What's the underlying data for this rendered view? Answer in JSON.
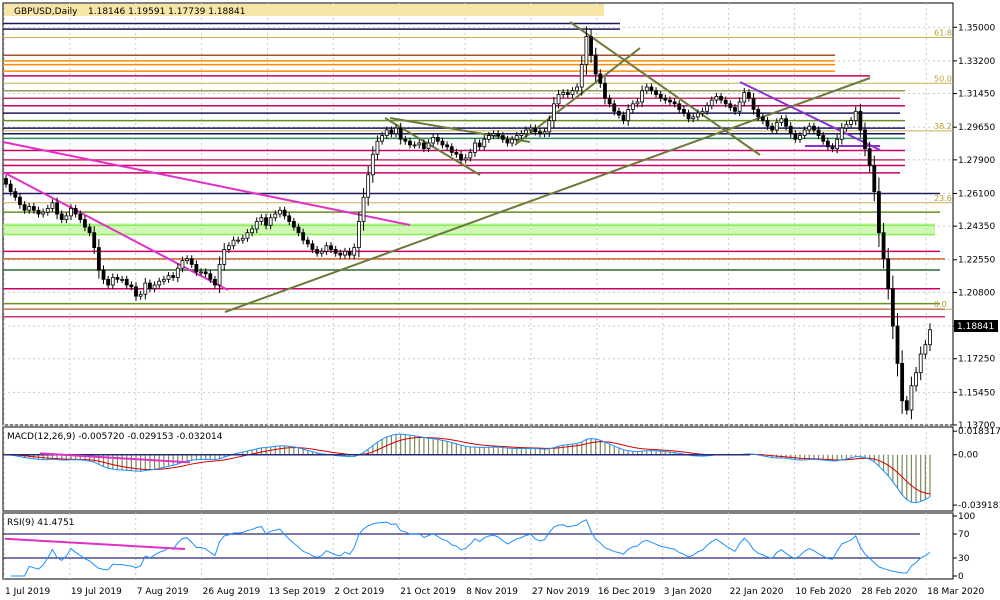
{
  "chart_data": [
    {
      "type": "candlestick",
      "title": "GBPUSD,Daily",
      "ohlc_header": "1.18146 1.19591 1.17739 1.18841",
      "last_price": "1.18841",
      "ylim": [
        1.137,
        1.363
      ],
      "y_ticks": [
        "1.35000",
        "1.33200",
        "1.31450",
        "1.29650",
        "1.27900",
        "1.26100",
        "1.24350",
        "1.22550",
        "1.20800",
        "1.19000",
        "1.17250",
        "1.15450",
        "1.13700"
      ],
      "x_ticks": [
        "1 Jul 2019",
        "19 Jul 2019",
        "7 Aug 2019",
        "26 Aug 2019",
        "13 Sep 2019",
        "2 Oct 2019",
        "21 Oct 2019",
        "8 Nov 2019",
        "27 Nov 2019",
        "16 Dec 2019",
        "3 Jan 2020",
        "22 Jan 2020",
        "10 Feb 2020",
        "28 Feb 2020",
        "18 Mar 2020"
      ],
      "fib_levels": [
        {
          "label": "61.8",
          "value": 1.3445
        },
        {
          "label": "50.0",
          "value": 1.32
        },
        {
          "label": "38.2",
          "value": 1.2945
        },
        {
          "label": "23.6",
          "value": 1.256
        },
        {
          "label": "0.0",
          "value": 1.199
        }
      ],
      "closes": [
        1.266,
        1.262,
        1.259,
        1.255,
        1.252,
        1.254,
        1.252,
        1.25,
        1.251,
        1.253,
        1.256,
        1.25,
        1.247,
        1.249,
        1.253,
        1.25,
        1.247,
        1.243,
        1.24,
        1.232,
        1.22,
        1.215,
        1.212,
        1.216,
        1.215,
        1.215,
        1.212,
        1.211,
        1.206,
        1.207,
        1.213,
        1.21,
        1.212,
        1.214,
        1.215,
        1.217,
        1.216,
        1.221,
        1.225,
        1.226,
        1.223,
        1.219,
        1.219,
        1.218,
        1.215,
        1.212,
        1.223,
        1.231,
        1.233,
        1.236,
        1.236,
        1.237,
        1.24,
        1.242,
        1.246,
        1.248,
        1.244,
        1.248,
        1.25,
        1.252,
        1.249,
        1.246,
        1.243,
        1.24,
        1.236,
        1.234,
        1.231,
        1.229,
        1.23,
        1.233,
        1.231,
        1.229,
        1.228,
        1.23,
        1.228,
        1.232,
        1.246,
        1.259,
        1.271,
        1.282,
        1.289,
        1.292,
        1.295,
        1.293,
        1.296,
        1.29,
        1.289,
        1.287,
        1.287,
        1.288,
        1.285,
        1.288,
        1.291,
        1.289,
        1.287,
        1.286,
        1.283,
        1.282,
        1.279,
        1.28,
        1.283,
        1.288,
        1.286,
        1.29,
        1.292,
        1.293,
        1.292,
        1.29,
        1.288,
        1.29,
        1.292,
        1.293,
        1.295,
        1.296,
        1.294,
        1.293,
        1.294,
        1.3,
        1.309,
        1.314,
        1.315,
        1.314,
        1.316,
        1.318,
        1.33,
        1.345,
        1.335,
        1.325,
        1.32,
        1.312,
        1.309,
        1.305,
        1.303,
        1.3,
        1.306,
        1.309,
        1.31,
        1.316,
        1.318,
        1.316,
        1.314,
        1.312,
        1.311,
        1.31,
        1.309,
        1.306,
        1.304,
        1.301,
        1.302,
        1.304,
        1.305,
        1.308,
        1.311,
        1.313,
        1.311,
        1.309,
        1.307,
        1.305,
        1.31,
        1.315,
        1.312,
        1.306,
        1.302,
        1.3,
        1.297,
        1.295,
        1.299,
        1.301,
        1.297,
        1.293,
        1.29,
        1.292,
        1.295,
        1.297,
        1.295,
        1.292,
        1.289,
        1.286,
        1.285,
        1.29,
        1.296,
        1.298,
        1.3,
        1.305,
        1.295,
        1.285,
        1.276,
        1.262,
        1.24,
        1.226,
        1.21,
        1.19,
        1.17,
        1.15,
        1.145,
        1.158,
        1.165,
        1.175,
        1.18,
        1.188
      ]
    },
    {
      "type": "line",
      "title": "MACD(12,26,9) -0.005720 -0.029153 -0.032014",
      "y_ticks": [
        "0.018317",
        "0.00",
        "-0.039181"
      ],
      "ylim": [
        -0.043,
        0.02
      ]
    },
    {
      "type": "line",
      "title": "RSI(9) 41.4751",
      "y_ticks": [
        "100",
        "70",
        "30",
        "0"
      ],
      "ylim": [
        0,
        100
      ],
      "levels": [
        70,
        30
      ]
    }
  ]
}
